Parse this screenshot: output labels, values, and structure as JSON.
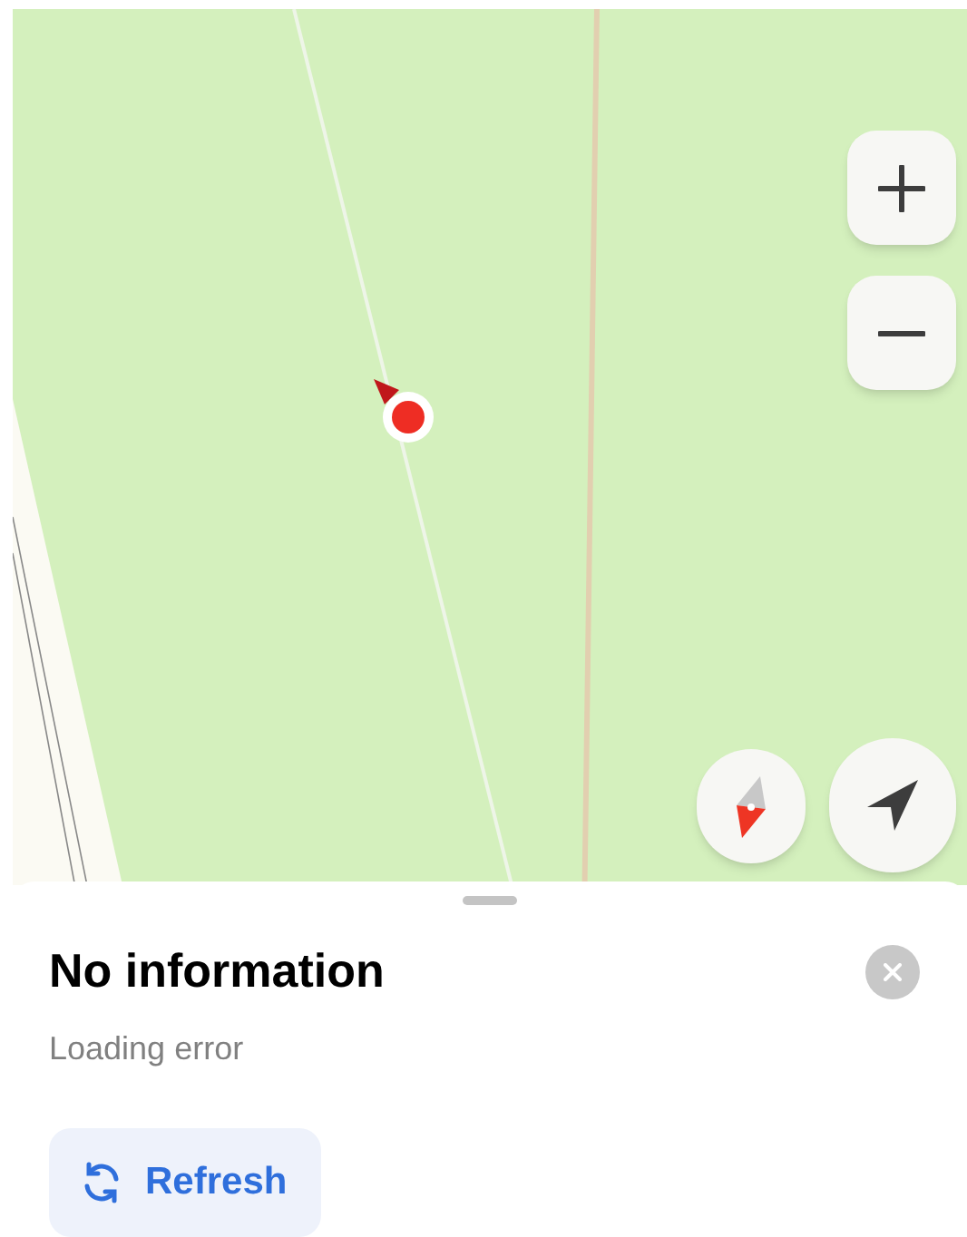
{
  "place_card": {
    "title": "No information",
    "subtitle": "Loading error",
    "refresh_button": "Refresh"
  }
}
